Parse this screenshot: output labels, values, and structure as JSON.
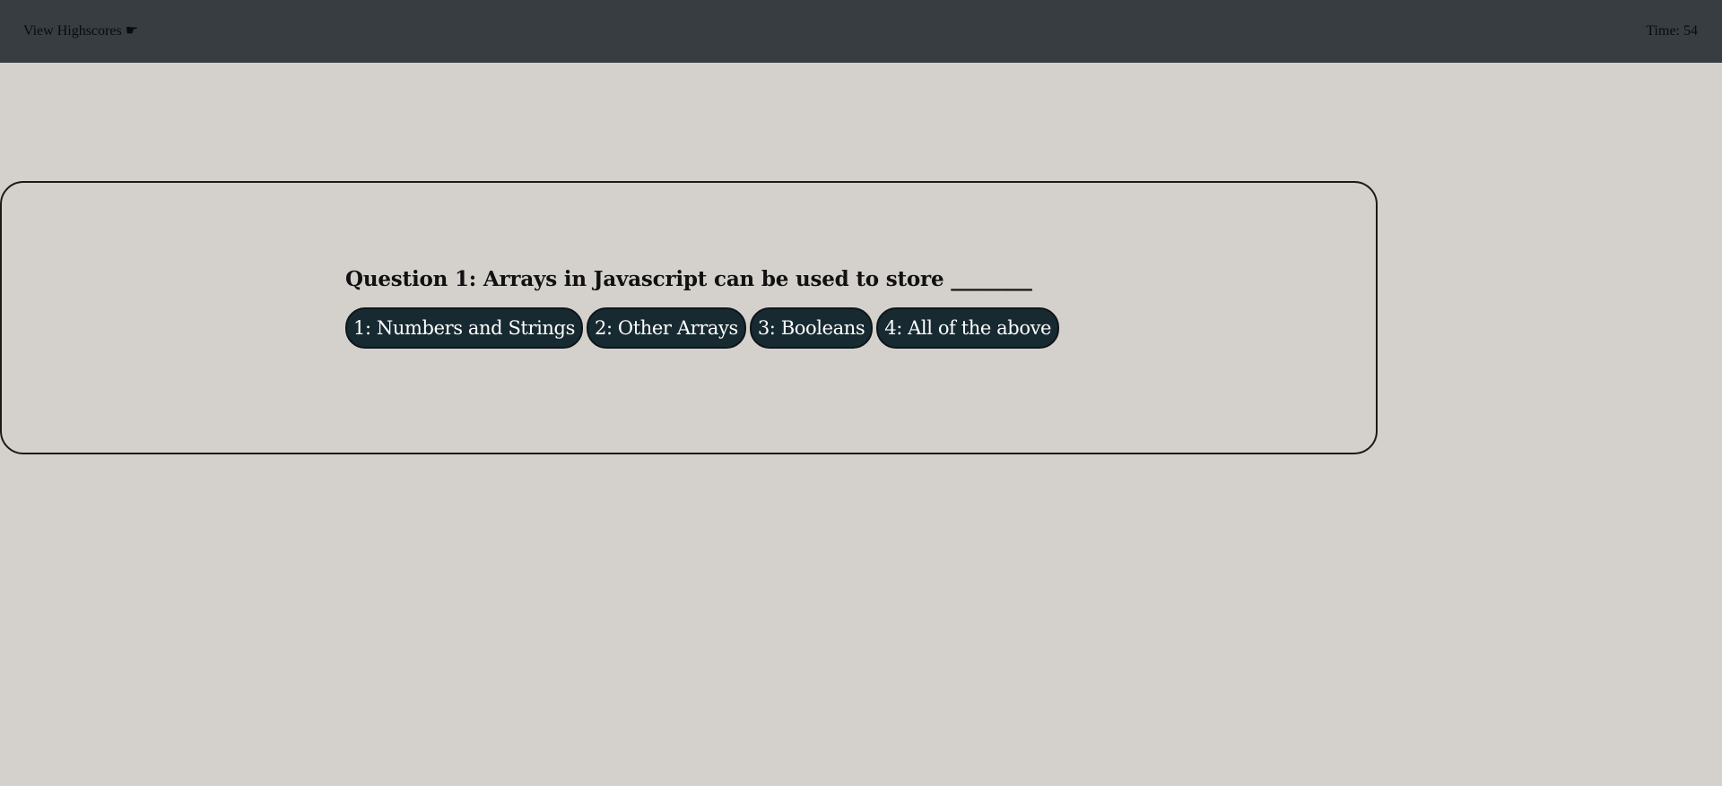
{
  "header": {
    "highscores_label": "View Highscores",
    "highscores_icon": "pointing-hand-icon",
    "timer_label": "Time:",
    "timer_value": "54",
    "background_color": "#373d41"
  },
  "quiz": {
    "question": "Question 1: Arrays in Javascript can be used to store ________",
    "answers": [
      {
        "label": "1: Numbers and Strings"
      },
      {
        "label": "2: Other Arrays"
      },
      {
        "label": "3: Booleans"
      },
      {
        "label": "4: All of the above"
      }
    ],
    "button_color": "#172a31"
  },
  "page": {
    "background_color": "#d4d1cc"
  }
}
